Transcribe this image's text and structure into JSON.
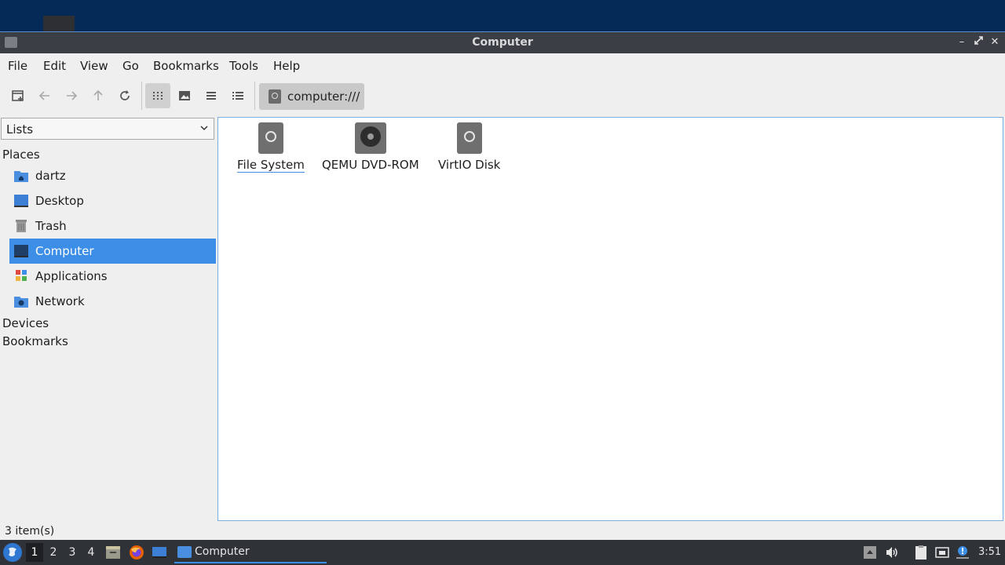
{
  "window": {
    "title": "Computer"
  },
  "menu": [
    "File",
    "Edit",
    "View",
    "Go",
    "Bookmarks",
    "Tools",
    "Help"
  ],
  "toolbar": {
    "buttons": [
      "new-tab-icon",
      "back-arrow-icon",
      "forward-arrow-icon",
      "up-arrow-icon",
      "reload-icon",
      "icon-view-icon",
      "thumbnail-view-icon",
      "compact-view-icon",
      "detailed-list-icon"
    ],
    "location": "computer:///"
  },
  "sidebar": {
    "selector": "Lists",
    "places_header": "Places",
    "places": [
      {
        "label": "dartz",
        "icon": "home-folder-icon"
      },
      {
        "label": "Desktop",
        "icon": "desktop-icon"
      },
      {
        "label": "Trash",
        "icon": "trash-icon"
      },
      {
        "label": "Computer",
        "icon": "computer-icon",
        "selected": true
      },
      {
        "label": "Applications",
        "icon": "applications-icon"
      },
      {
        "label": "Network",
        "icon": "network-folder-icon"
      }
    ],
    "devices_header": "Devices",
    "bookmarks_header": "Bookmarks"
  },
  "content": {
    "items": [
      {
        "label": "File System",
        "icon": "drive-icon"
      },
      {
        "label": "QEMU DVD-ROM",
        "icon": "optical-drive-icon"
      },
      {
        "label": "VirtIO Disk",
        "icon": "drive-icon"
      }
    ]
  },
  "status": "3 item(s)",
  "taskbar": {
    "workspaces": [
      "1",
      "2",
      "3",
      "4"
    ],
    "task_label": "Computer",
    "clock": "3:51"
  },
  "colors": {
    "accent": "#3d8ee6",
    "titlebar": "#3b3e44",
    "taskbar": "#2f3237",
    "desktop": "#062a57"
  }
}
